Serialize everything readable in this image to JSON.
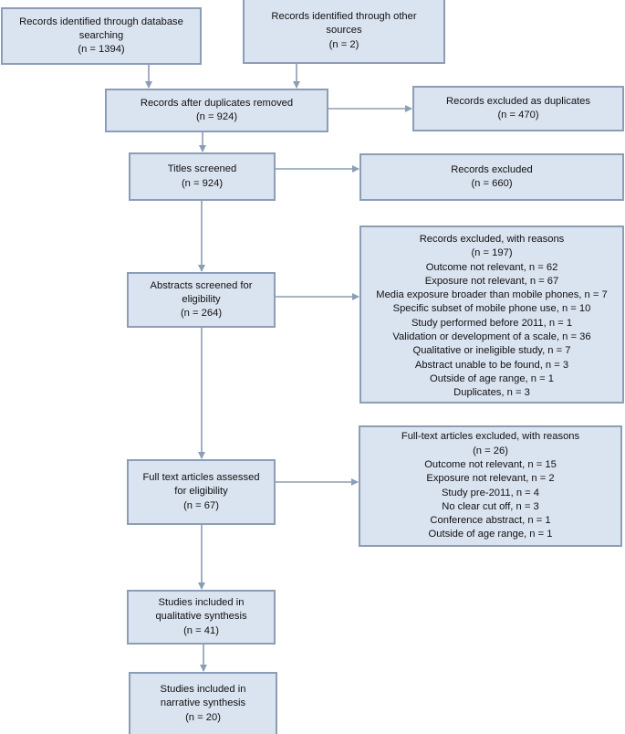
{
  "diagram": {
    "type": "PRISMA flow diagram",
    "colors": {
      "box_fill": "#dae3f0",
      "box_border": "#8c9db6",
      "arrow": "#8c9db6"
    },
    "boxes": {
      "database_search": {
        "title": "Records identified through database searching",
        "count": "(n = 1394)"
      },
      "other_sources": {
        "title": "Records identified through other sources",
        "count": "(n = 2)"
      },
      "after_duplicates": {
        "title": "Records after duplicates removed",
        "count": "(n = 924)"
      },
      "excluded_duplicates": {
        "title": "Records excluded as duplicates",
        "count": "(n = 470)"
      },
      "titles_screened": {
        "title": "Titles screened",
        "count": "(n = 924)"
      },
      "records_excluded": {
        "title": "Records excluded",
        "count": "(n = 660)"
      },
      "abstracts_screened": {
        "title": "Abstracts screened for eligibility",
        "count": "(n = 264)"
      },
      "abstracts_excluded": {
        "title": "Records excluded, with reasons",
        "count": "(n = 197)",
        "reasons": [
          "Outcome not relevant, n = 62",
          "Exposure not relevant, n = 67",
          "Media exposure broader than mobile phones, n = 7",
          "Specific subset of mobile phone use, n = 10",
          "Study performed before 2011, n = 1",
          "Validation or development of a scale, n = 36",
          "Qualitative or ineligible study, n = 7",
          "Abstract unable to be found, n = 3",
          "Outside of age range, n = 1",
          "Duplicates, n = 3"
        ]
      },
      "fulltext_assessed": {
        "title": "Full text articles assessed for eligibility",
        "count": "(n = 67)"
      },
      "fulltext_excluded": {
        "title": "Full-text articles excluded, with reasons",
        "count": "(n = 26)",
        "reasons": [
          "Outcome not relevant, n = 15",
          "Exposure not relevant, n = 2",
          "Study pre-2011, n = 4",
          "No clear cut off, n = 3",
          "Conference abstract, n = 1",
          "Outside of age range, n = 1"
        ]
      },
      "qualitative_synthesis": {
        "title": "Studies included in qualitative synthesis",
        "count": "(n = 41)"
      },
      "narrative_synthesis": {
        "title": "Studies included in narrative synthesis",
        "count": "(n = 20)"
      }
    }
  }
}
